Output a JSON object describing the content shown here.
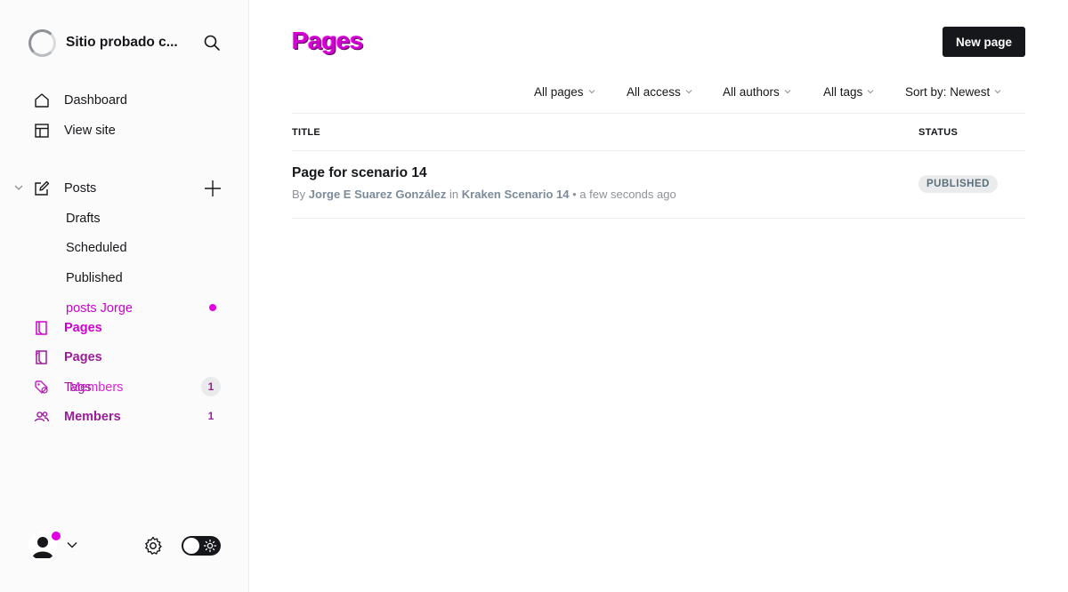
{
  "sidebar": {
    "site_name": "Sitio probado c...",
    "nav": {
      "dashboard": "Dashboard",
      "view_site": "View site",
      "posts": "Posts",
      "drafts": "Drafts",
      "scheduled": "Scheduled",
      "published": "Published",
      "posts_jorge": "posts Jorge",
      "pages_a": "Pages",
      "pages_b": "Pages",
      "tags": "Tags",
      "members_a": "Members",
      "members_b": "Members"
    },
    "members_count_a": "1",
    "members_count_b": "1"
  },
  "main": {
    "title": "Pages",
    "new_button": "New page",
    "filters": [
      "All pages",
      "All access",
      "All authors",
      "All tags",
      "Sort by: Newest"
    ],
    "columns": {
      "title": "TITLE",
      "status": "STATUS"
    },
    "rows": [
      {
        "title": "Page for scenario 14",
        "by": "By",
        "author": "Jorge E Suarez González",
        "in": "in",
        "tag": "Kraken Scenario 14",
        "sep": "•",
        "time": "a few seconds ago",
        "status": "PUBLISHED"
      }
    ]
  },
  "colors": {
    "accent": "#d100d1",
    "accent_dark": "#9a1e9a",
    "primary_button": "#15171a",
    "status_pill_bg": "#e9ebed"
  },
  "icons": [
    "search-icon",
    "home-icon",
    "layout-icon",
    "edit-icon",
    "plus-icon",
    "chevron-down-icon",
    "page-icon",
    "tag-icon",
    "members-icon",
    "gear-icon",
    "sun-icon",
    "avatar-icon"
  ]
}
